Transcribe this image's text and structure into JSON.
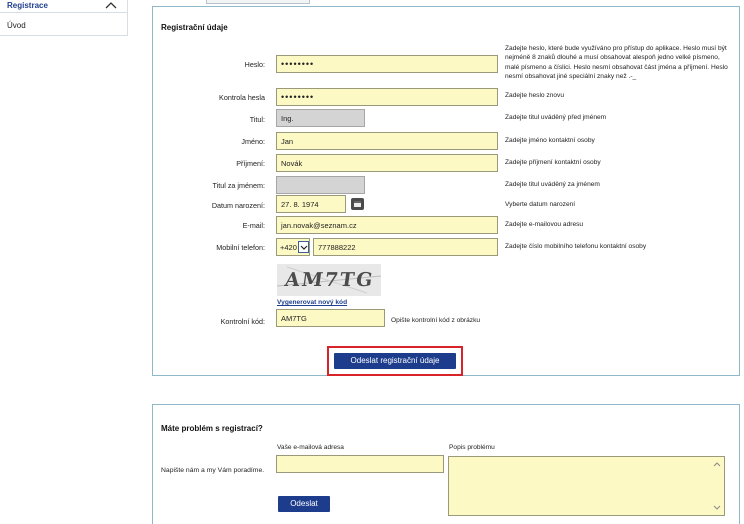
{
  "sidebar": {
    "section_label": "Registrace",
    "items": [
      {
        "label": "Úvod"
      }
    ]
  },
  "registration": {
    "title": "Registrační údaje",
    "fields": {
      "password": {
        "label": "Heslo:",
        "value": "••••••••",
        "help": "Zadejte heslo, které bude využíváno pro přístup do aplikace. Heslo musí být nejméně 8 znaků dlouhé a musí obsahovat alespoň jedno velké písmeno, malé písmeno a číslici. Heslo nesmí obsahovat část jména a příjmení. Heslo nesmí obsahovat jiné speciální znaky než .-_"
      },
      "password_confirm": {
        "label": "Kontrola hesla",
        "value": "••••••••",
        "help": "Zadejte heslo znovu"
      },
      "title_before": {
        "label": "Titul:",
        "value": "Ing.",
        "help": "Zadejte titul uváděný před jménem"
      },
      "first_name": {
        "label": "Jméno:",
        "value": "Jan",
        "help": "Zadejte jméno kontaktní osoby"
      },
      "last_name": {
        "label": "Příjmení:",
        "value": "Novák",
        "help": "Zadejte příjmení kontaktní osoby"
      },
      "title_after": {
        "label": "Titul za jménem:",
        "value": "",
        "help": "Zadejte titul uváděný za jménem"
      },
      "birth_date": {
        "label": "Datum narození:",
        "value": "27. 8. 1974",
        "help": "Vyberte datum narození"
      },
      "email": {
        "label": "E-mail:",
        "value": "jan.novak@seznam.cz",
        "help": "Zadejte e-mailovou adresu"
      },
      "phone": {
        "label": "Mobilní telefon:",
        "prefix": "+420",
        "value": "777888222",
        "help": "Zadejte číslo mobilního telefonu kontaktní osoby"
      },
      "captcha": {
        "image_text": "AM7TG",
        "regenerate_link": "Vygenerovat nový kód",
        "label": "Kontrolní kód:",
        "value": "AM7TG",
        "help": "Opište kontrolní kód z obrázku"
      }
    },
    "submit_label": "Odeslat registrační údaje"
  },
  "problem": {
    "title": "Máte problém s registrací?",
    "prompt": "Napište nám a my Vám poradíme.",
    "email_label": "Vaše e-mailová adresa",
    "email_value": "",
    "description_label": "Popis problému",
    "description_value": "",
    "send_label": "Odeslat"
  },
  "colors": {
    "accent": "#1d3d8c",
    "input_bg": "#fdf9c4",
    "panel_border": "#8fb8c9",
    "highlight": "#d8232a"
  }
}
